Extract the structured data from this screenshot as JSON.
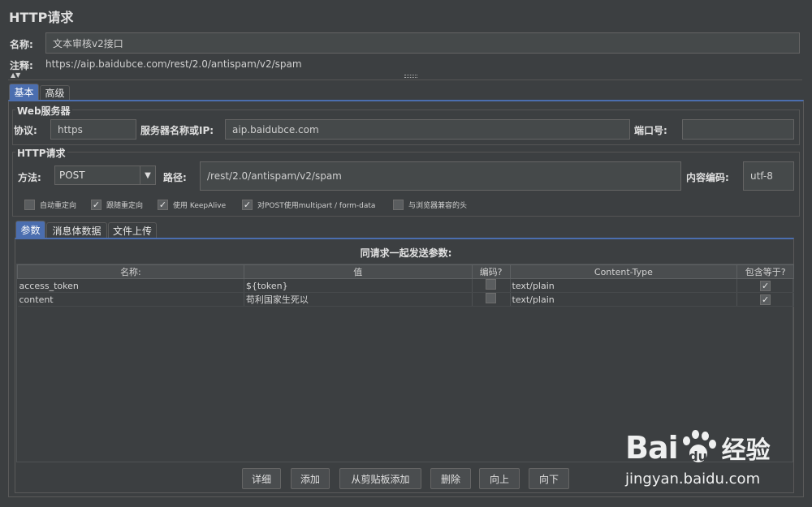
{
  "page_title": "HTTP请求",
  "name": {
    "label": "名称:",
    "value": "文本审核v2接口"
  },
  "comment": {
    "label": "注释:",
    "value": "https://aip.baidubce.com/rest/2.0/antispam/v2/spam"
  },
  "tabs": [
    {
      "label": "基本"
    },
    {
      "label": "高级"
    }
  ],
  "web_server": {
    "title": "Web服务器",
    "protocol_label": "协议:",
    "protocol_value": "https",
    "server_label": "服务器名称或IP:",
    "server_value": "aip.baidubce.com",
    "port_label": "端口号:",
    "port_value": ""
  },
  "http_request": {
    "title": "HTTP请求",
    "method_label": "方法:",
    "method_value": "POST",
    "path_label": "路径:",
    "path_value": "/rest/2.0/antispam/v2/spam",
    "encoding_label": "内容编码:",
    "encoding_value": "utf-8"
  },
  "options": [
    {
      "label": "自动重定向",
      "checked": false
    },
    {
      "label": "跟随重定向",
      "checked": true
    },
    {
      "label": "使用 KeepAlive",
      "checked": true
    },
    {
      "label": "对POST使用multipart / form-data",
      "checked": true
    },
    {
      "label": "与浏览器兼容的头",
      "checked": false
    }
  ],
  "sub_tabs": [
    {
      "label": "参数"
    },
    {
      "label": "消息体数据"
    },
    {
      "label": "文件上传"
    }
  ],
  "params": {
    "caption": "同请求一起发送参数:",
    "columns": [
      "名称:",
      "值",
      "编码?",
      "Content-Type",
      "包含等于?"
    ],
    "rows": [
      {
        "name": "access_token",
        "value": "${token}",
        "encode": false,
        "content_type": "text/plain",
        "include_equals": true
      },
      {
        "name": "content",
        "value": "苟利国家生死以",
        "encode": false,
        "content_type": "text/plain",
        "include_equals": true
      }
    ]
  },
  "buttons": {
    "detail": "详细",
    "add": "添加",
    "add_clipboard": "从剪贴板添加",
    "delete": "删除",
    "up": "向上",
    "down": "向下"
  },
  "watermark": {
    "brand": "Bai",
    "brand2": "du",
    "suffix": "经验",
    "url": "jingyan.baidu.com"
  }
}
